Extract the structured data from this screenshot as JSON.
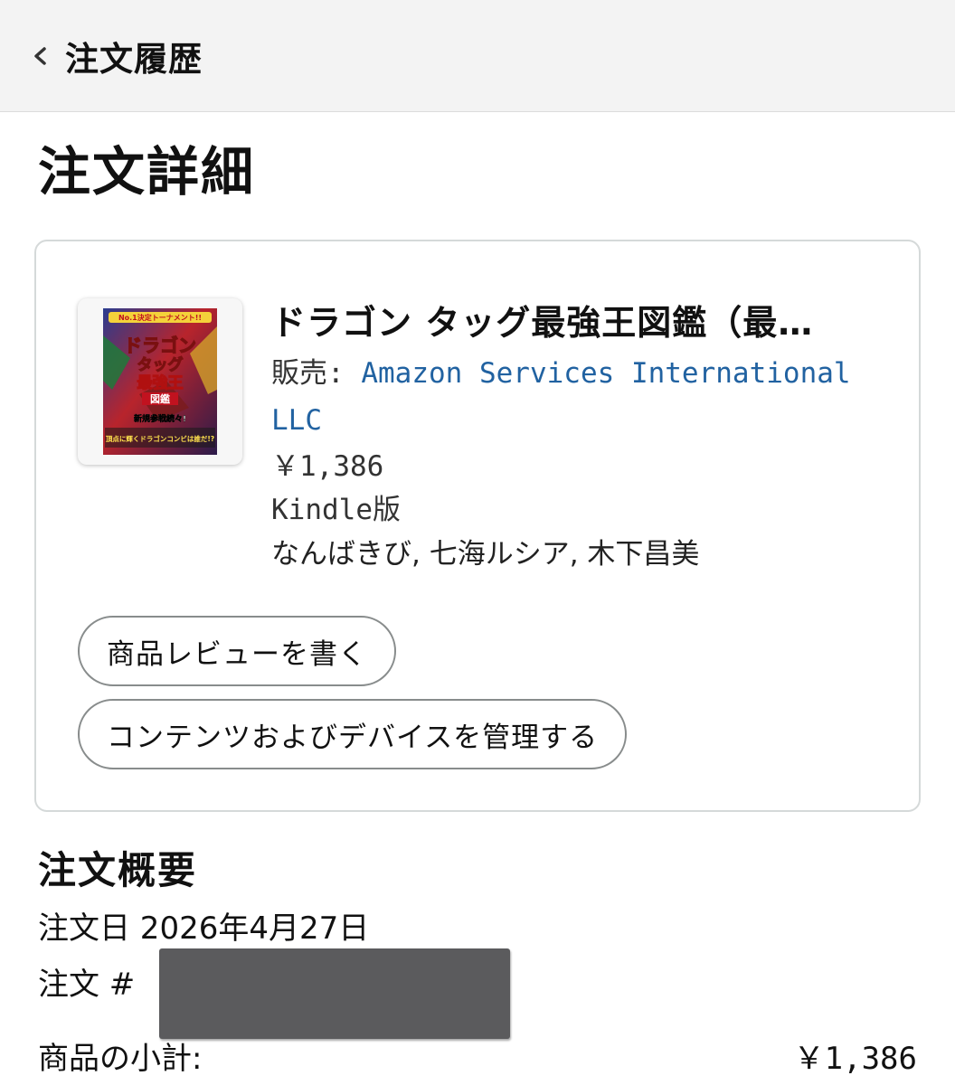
{
  "header": {
    "back_label": "注文履歴"
  },
  "page_title": "注文詳細",
  "item": {
    "title": "ドラゴン タッグ最強王図鑑（最…",
    "seller_label": "販売: ",
    "seller_name": "Amazon Services International LLC",
    "price": "￥1,386",
    "format": "Kindle版",
    "authors": "なんばきび, 七海ルシア, 木下昌美",
    "cover_text": {
      "top": "No.1決定トーナメント!!",
      "main_line1": "ドラゴン",
      "main_line2": "タッグ",
      "main_line3": "最強王",
      "main_line4": "図鑑",
      "bottom_line1": "新規参戦続々!",
      "bottom_line2": "頂点に輝くドラゴンコンビは誰だ!?"
    }
  },
  "actions": {
    "review_label": "商品レビューを書く",
    "manage_label": "コンテンツおよびデバイスを管理する"
  },
  "summary": {
    "title": "注文概要",
    "order_date": "注文日 2026年4月27日",
    "order_number_label": "注文 #",
    "subtotal_label": "商品の小計:",
    "subtotal_value": "￥1,386"
  },
  "colors": {
    "link": "#2162a1",
    "topbar": "#f3f3f3",
    "card_border": "#d5d9d9",
    "redaction": "#5b5b5d"
  }
}
